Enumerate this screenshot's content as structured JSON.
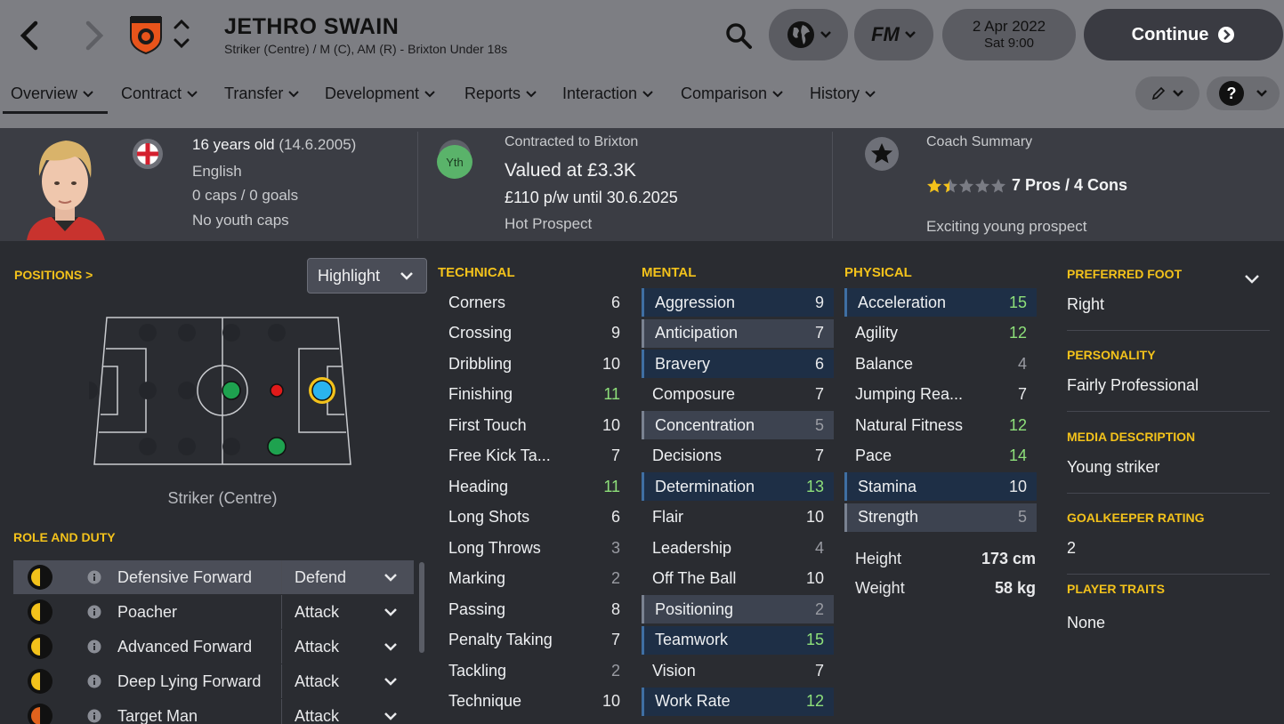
{
  "header": {
    "player_name": "JETHRO SWAIN",
    "subtitle": "Striker (Centre) / M (C), AM (R) - Brixton Under 18s",
    "club_badge_text": "BRIXTON",
    "date": "2 Apr 2022",
    "time": "Sat 9:00",
    "continue_label": "Continue",
    "fm_label": "FM"
  },
  "tabs": [
    {
      "label": "Overview"
    },
    {
      "label": "Contract"
    },
    {
      "label": "Transfer"
    },
    {
      "label": "Development"
    },
    {
      "label": "Reports"
    },
    {
      "label": "Interaction"
    },
    {
      "label": "Comparison"
    },
    {
      "label": "History"
    }
  ],
  "overview": {
    "age": "16 years old",
    "dob": "(14.6.2005)",
    "nationality": "English",
    "caps": "0 caps / 0 goals",
    "youth_caps": "No youth caps",
    "contract_badge": "Yth",
    "contracted_to": "Contracted to Brixton",
    "value": "Valued at £3.3K",
    "wage": "£110 p/w until 30.6.2025",
    "status": "Hot Prospect",
    "coach_title": "Coach Summary",
    "pros_cons": "7 Pros / 4 Cons",
    "coach_rating_stars": 1.5,
    "coach_note": "Exciting young prospect"
  },
  "positions": {
    "title": "POSITIONS >",
    "highlight_label": "Highlight",
    "position_label": "Striker (Centre)"
  },
  "roles": {
    "title": "ROLE AND DUTY",
    "items": [
      {
        "name": "Defensive Forward",
        "duty": "Defend"
      },
      {
        "name": "Poacher",
        "duty": "Attack"
      },
      {
        "name": "Advanced Forward",
        "duty": "Attack"
      },
      {
        "name": "Deep Lying Forward",
        "duty": "Attack"
      },
      {
        "name": "Target Man",
        "duty": "Attack"
      }
    ]
  },
  "technical": {
    "title": "TECHNICAL",
    "items": [
      {
        "name": "Corners",
        "value": "6"
      },
      {
        "name": "Crossing",
        "value": "9"
      },
      {
        "name": "Dribbling",
        "value": "10"
      },
      {
        "name": "Finishing",
        "value": "11"
      },
      {
        "name": "First Touch",
        "value": "10"
      },
      {
        "name": "Free Kick Ta...",
        "value": "7"
      },
      {
        "name": "Heading",
        "value": "11"
      },
      {
        "name": "Long Shots",
        "value": "6"
      },
      {
        "name": "Long Throws",
        "value": "3"
      },
      {
        "name": "Marking",
        "value": "2"
      },
      {
        "name": "Passing",
        "value": "8"
      },
      {
        "name": "Penalty Taking",
        "value": "7"
      },
      {
        "name": "Tackling",
        "value": "2"
      },
      {
        "name": "Technique",
        "value": "10"
      }
    ]
  },
  "mental": {
    "title": "MENTAL",
    "items": [
      {
        "name": "Aggression",
        "value": "9"
      },
      {
        "name": "Anticipation",
        "value": "7"
      },
      {
        "name": "Bravery",
        "value": "6"
      },
      {
        "name": "Composure",
        "value": "7"
      },
      {
        "name": "Concentration",
        "value": "5"
      },
      {
        "name": "Decisions",
        "value": "7"
      },
      {
        "name": "Determination",
        "value": "13"
      },
      {
        "name": "Flair",
        "value": "10"
      },
      {
        "name": "Leadership",
        "value": "4"
      },
      {
        "name": "Off The Ball",
        "value": "10"
      },
      {
        "name": "Positioning",
        "value": "2"
      },
      {
        "name": "Teamwork",
        "value": "15"
      },
      {
        "name": "Vision",
        "value": "7"
      },
      {
        "name": "Work Rate",
        "value": "12"
      }
    ]
  },
  "physical": {
    "title": "PHYSICAL",
    "items": [
      {
        "name": "Acceleration",
        "value": "15"
      },
      {
        "name": "Agility",
        "value": "12"
      },
      {
        "name": "Balance",
        "value": "4"
      },
      {
        "name": "Jumping Rea...",
        "value": "7"
      },
      {
        "name": "Natural Fitness",
        "value": "12"
      },
      {
        "name": "Pace",
        "value": "14"
      },
      {
        "name": "Stamina",
        "value": "10"
      },
      {
        "name": "Strength",
        "value": "5"
      }
    ],
    "height_label": "Height",
    "height": "173 cm",
    "weight_label": "Weight",
    "weight": "58 kg"
  },
  "info": {
    "preferred_foot_label": "PREFERRED FOOT",
    "preferred_foot": "Right",
    "personality_label": "PERSONALITY",
    "personality": "Fairly Professional",
    "media_label": "MEDIA DESCRIPTION",
    "media": "Young striker",
    "gk_label": "GOALKEEPER RATING",
    "gk": "2",
    "traits_label": "PLAYER TRAITS",
    "traits": "None"
  },
  "colors": {
    "topbar": "#7d7e83",
    "accent_yellow": "#f3c21b",
    "good_value": "#8ee07a",
    "low_value": "#9a9ca3",
    "highlight_dark": "#1e2f46"
  }
}
